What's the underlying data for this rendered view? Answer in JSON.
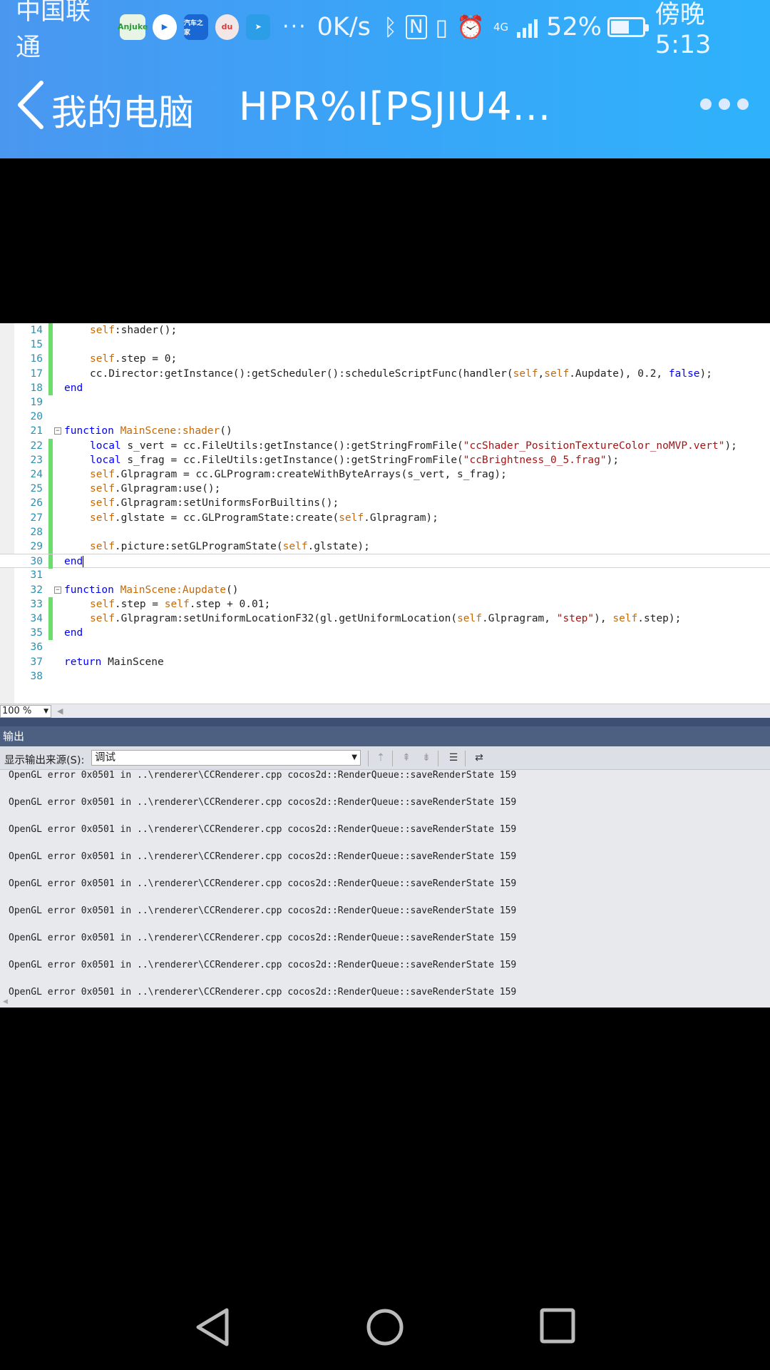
{
  "status_bar": {
    "carrier": "中国联通",
    "app_icons": [
      {
        "name": "anjuke-icon",
        "label": "Anjuke"
      },
      {
        "name": "video-app-icon",
        "label": ""
      },
      {
        "name": "car-app-icon",
        "label": "汽车之家"
      },
      {
        "name": "baidu-app-icon",
        "label": "du"
      },
      {
        "name": "bird-app-icon",
        "label": ""
      }
    ],
    "overflow": "···",
    "net_speed": "0K/s",
    "network": "4G",
    "battery_percent": "52%",
    "battery_level": 0.52,
    "time": "傍晚5:13"
  },
  "nav": {
    "back_label": "我的电脑",
    "title": "HPR%I[PSJIU4..."
  },
  "editor": {
    "lines": [
      {
        "n": "14",
        "parts": [
          [
            "self",
            "self"
          ],
          [
            "",
            ":shader();"
          ]
        ]
      },
      {
        "n": "15",
        "parts": []
      },
      {
        "n": "16",
        "parts": [
          [
            "self",
            "self"
          ],
          [
            "",
            ".step = 0;"
          ]
        ]
      },
      {
        "n": "17",
        "parts": [
          [
            "",
            "cc.Director:getInstance():getScheduler():scheduleScriptFunc(handler("
          ],
          [
            "self",
            "self"
          ],
          [
            "",
            ","
          ],
          [
            "self",
            "self"
          ],
          [
            "",
            ".Aupdate), 0.2, "
          ],
          [
            "kw",
            "false"
          ],
          [
            "",
            ");"
          ]
        ]
      },
      {
        "n": "18",
        "parts": [
          [
            "kw",
            "end"
          ]
        ]
      },
      {
        "n": "19",
        "parts": []
      },
      {
        "n": "20",
        "parts": []
      },
      {
        "n": "21",
        "parts": [
          [
            "kw",
            "function "
          ],
          [
            "fn",
            "MainScene:shader"
          ],
          [
            "",
            "()"
          ]
        ]
      },
      {
        "n": "22",
        "parts": [
          [
            "kw",
            "local"
          ],
          [
            "",
            " s_vert = cc.FileUtils:getInstance():getStringFromFile("
          ],
          [
            "str",
            "\"ccShader_PositionTextureColor_noMVP.vert\""
          ],
          [
            "",
            ");"
          ]
        ]
      },
      {
        "n": "23",
        "parts": [
          [
            "kw",
            "local"
          ],
          [
            "",
            " s_frag = cc.FileUtils:getInstance():getStringFromFile("
          ],
          [
            "str",
            "\"ccBrightness_0_5.frag\""
          ],
          [
            "",
            ");"
          ]
        ]
      },
      {
        "n": "24",
        "parts": [
          [
            "self",
            "self"
          ],
          [
            "",
            ".Glpragram = cc.GLProgram:createWithByteArrays(s_vert, s_frag);"
          ]
        ]
      },
      {
        "n": "25",
        "parts": [
          [
            "self",
            "self"
          ],
          [
            "",
            ".Glpragram:use();"
          ]
        ]
      },
      {
        "n": "26",
        "parts": [
          [
            "self",
            "self"
          ],
          [
            "",
            ".Glpragram:setUniformsForBuiltins();"
          ]
        ]
      },
      {
        "n": "27",
        "parts": [
          [
            "self",
            "self"
          ],
          [
            "",
            ".glstate = cc.GLProgramState:create("
          ],
          [
            "self",
            "self"
          ],
          [
            "",
            ".Glpragram);"
          ]
        ]
      },
      {
        "n": "28",
        "parts": []
      },
      {
        "n": "29",
        "parts": [
          [
            "self",
            "self"
          ],
          [
            "",
            ".picture:setGLProgramState("
          ],
          [
            "self",
            "self"
          ],
          [
            "",
            ".glstate);"
          ]
        ]
      },
      {
        "n": "30",
        "parts": [
          [
            "kw",
            "end"
          ]
        ]
      },
      {
        "n": "31",
        "parts": []
      },
      {
        "n": "32",
        "parts": [
          [
            "kw",
            "function "
          ],
          [
            "fn",
            "MainScene:Aupdate"
          ],
          [
            "",
            "()"
          ]
        ]
      },
      {
        "n": "33",
        "parts": [
          [
            "self",
            "self"
          ],
          [
            "",
            ".step = "
          ],
          [
            "self",
            "self"
          ],
          [
            "",
            ".step + 0.01;"
          ]
        ]
      },
      {
        "n": "34",
        "parts": [
          [
            "self",
            "self"
          ],
          [
            "",
            ".Glpragram:setUniformLocationF32(gl.getUniformLocation("
          ],
          [
            "self",
            "self"
          ],
          [
            "",
            ".Glpragram, "
          ],
          [
            "str",
            "\"step\""
          ],
          [
            "",
            "), "
          ],
          [
            "self",
            "self"
          ],
          [
            "",
            ".step);"
          ]
        ]
      },
      {
        "n": "35",
        "parts": [
          [
            "kw",
            "end"
          ]
        ]
      },
      {
        "n": "36",
        "parts": []
      },
      {
        "n": "37",
        "parts": [
          [
            "kw",
            "return"
          ],
          [
            "",
            " MainScene"
          ]
        ]
      },
      {
        "n": "38",
        "parts": []
      }
    ],
    "zoom": "100 %"
  },
  "output": {
    "header": "输出",
    "source_label": "显示输出来源(S):",
    "source_value": "调试",
    "lines": [
      "OpenGL error 0x0501 in ..\\renderer\\CCRenderer.cpp cocos2d::RenderQueue::saveRenderState 159",
      "OpenGL error 0x0501 in ..\\renderer\\CCRenderer.cpp cocos2d::RenderQueue::saveRenderState 159",
      "OpenGL error 0x0501 in ..\\renderer\\CCRenderer.cpp cocos2d::RenderQueue::saveRenderState 159",
      "OpenGL error 0x0501 in ..\\renderer\\CCRenderer.cpp cocos2d::RenderQueue::saveRenderState 159",
      "OpenGL error 0x0501 in ..\\renderer\\CCRenderer.cpp cocos2d::RenderQueue::saveRenderState 159",
      "OpenGL error 0x0501 in ..\\renderer\\CCRenderer.cpp cocos2d::RenderQueue::saveRenderState 159",
      "OpenGL error 0x0501 in ..\\renderer\\CCRenderer.cpp cocos2d::RenderQueue::saveRenderState 159",
      "OpenGL error 0x0501 in ..\\renderer\\CCRenderer.cpp cocos2d::RenderQueue::saveRenderState 159",
      "OpenGL error 0x0501 in ..\\renderer\\CCRenderer.cpp cocos2d::RenderQueue::saveRenderState 159"
    ]
  },
  "system_nav": {
    "back": "back-icon",
    "home": "home-icon",
    "recents": "recents-icon"
  }
}
